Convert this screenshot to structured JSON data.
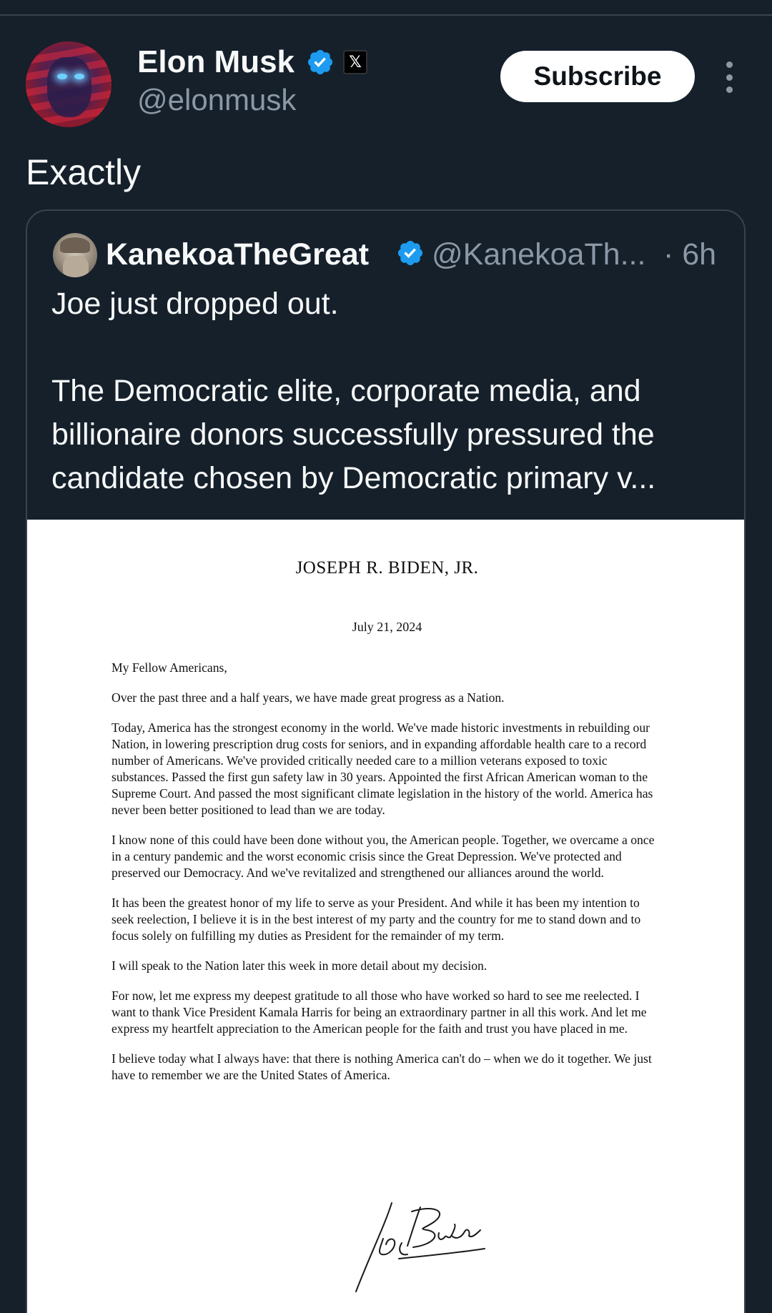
{
  "post": {
    "author_name": "Elon Musk",
    "author_handle": "@elonmusk",
    "x_badge": "𝕏",
    "subscribe_label": "Subscribe",
    "text": "Exactly"
  },
  "quoted": {
    "author_name": "KanekoaTheGreat",
    "author_handle": "@KanekoaTh...",
    "time": "· 6h",
    "text": "Joe just dropped out.\n\nThe Democratic elite, corporate media, and billionaire donors successfully pressured the candidate chosen by Democratic primary v..."
  },
  "letter": {
    "heading": "JOSEPH R. BIDEN, JR.",
    "date": "July 21, 2024",
    "salutation": "My Fellow Americans,",
    "paragraphs": [
      "Over the past three and a half years, we have made great progress as a Nation.",
      "Today, America has the strongest economy in the world. We've made historic investments in rebuilding our Nation, in lowering prescription drug costs for seniors, and in expanding affordable health care to a record number of Americans. We've provided critically needed care to a million veterans exposed to toxic substances. Passed the first gun safety law in 30 years. Appointed the first African American woman to the Supreme Court. And passed the most significant climate legislation in the history of the world. America has never been better positioned to lead than we are today.",
      "I know none of this could have been done without you, the American people. Together, we overcame a once in a century pandemic and the worst economic crisis since the Great Depression. We've protected and preserved our Democracy. And we've revitalized and strengthened our alliances around the world.",
      "It has been the greatest honor of my life to serve as your President. And while it has been my intention to seek reelection, I believe it is in the best interest of my party and the country for me to stand down and to focus solely on fulfilling my duties as President for the remainder of my term.",
      "I will speak to the Nation later this week in more detail about my decision.",
      "For now, let me express my deepest gratitude to all those who have worked so hard to see me reelected. I want to thank Vice President Kamala Harris for being an extraordinary partner in all this work. And let me express my heartfelt appreciation to the American people for the faith and trust you have placed in me.",
      "I believe today what I always have: that there is nothing America can't do – when we do it together. We just have to remember we are the United States of America."
    ],
    "signature": "Joe Biden"
  },
  "colors": {
    "background": "#15202b",
    "verified": "#1d9bf0",
    "secondary_text": "#8b98a5",
    "border": "#38444d"
  },
  "icons": {
    "verified": "verified-badge-icon",
    "x_logo": "x-logo-icon",
    "more": "more-vertical-icon"
  }
}
